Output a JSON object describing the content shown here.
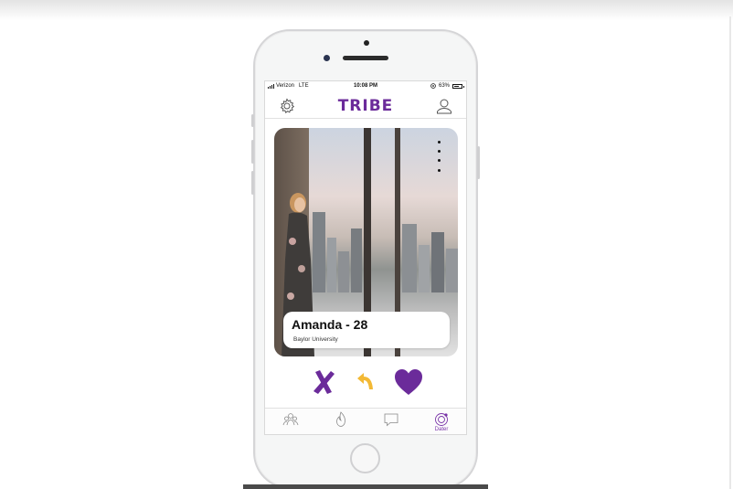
{
  "status_bar": {
    "carrier": "Verizon",
    "network": "LTE",
    "time": "10:08 PM",
    "battery": "63%"
  },
  "header": {
    "logo": "TRIBE"
  },
  "profile": {
    "name_age": "Amanda - 28",
    "school": "Baylor University"
  },
  "actions": [
    "x-icon",
    "undo-arrow-icon",
    "heart-icon"
  ],
  "tabs": [
    {
      "icon": "group-icon",
      "label": ""
    },
    {
      "icon": "flame-icon",
      "label": ""
    },
    {
      "icon": "chat-icon",
      "label": ""
    },
    {
      "icon": "refresh-icon",
      "label": "Dater"
    }
  ],
  "colors": {
    "brand": "#6b2b9a",
    "undo": "#f3b935",
    "active_tab": "#7a35a8"
  }
}
